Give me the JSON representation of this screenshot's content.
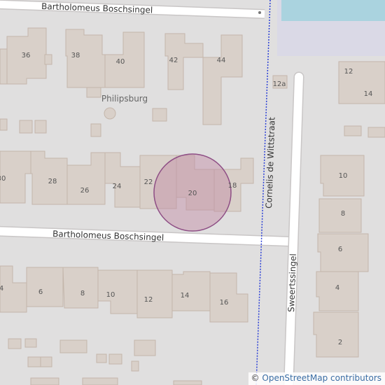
{
  "streets": {
    "top": "Bartholomeus Boschsingel",
    "middle": "Bartholomeus Boschsingel",
    "cornelis": "Cornelis de Wittstraat",
    "sweerts": "Sweertssingel"
  },
  "place_label": "Philipsburg",
  "house_numbers": {
    "n36": "36",
    "n38": "38",
    "n40": "40",
    "n42": "42",
    "n44": "44",
    "n12a": "12a",
    "n12": "12",
    "n14": "14",
    "n30": "30",
    "n28": "28",
    "n26": "26",
    "n24": "24",
    "n22": "22",
    "n20": "20",
    "n18": "18",
    "n10r": "10",
    "n8r": "8",
    "n6r": "6",
    "n4r": "4",
    "n2r": "2",
    "n4": "4",
    "n6": "6",
    "n8": "8",
    "n10": "10",
    "n12b": "12",
    "n14b": "14",
    "n16": "16"
  },
  "attribution": {
    "symbol": "©",
    "text": "OpenStreetMap contributors"
  },
  "colors": {
    "background": "#e0dfdf",
    "building": "#d9d0c9",
    "road": "#ffffff",
    "water": "#aad3df",
    "highlight": "#c18aa5",
    "path": "#2a3fd6"
  },
  "marker": {
    "type": "circle",
    "label": "20"
  }
}
